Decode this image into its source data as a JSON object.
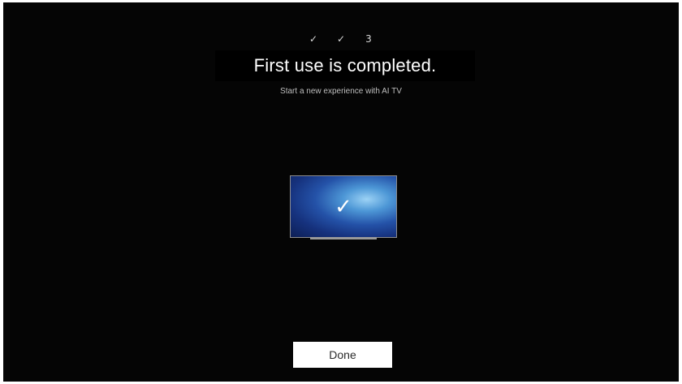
{
  "progress": {
    "steps": [
      "✓",
      "✓",
      "3"
    ]
  },
  "main": {
    "title": "First use is completed.",
    "subtitle": "Start a new experience with AI TV"
  },
  "illustration": {
    "check_glyph": "✓",
    "icon": "tv-check-icon"
  },
  "actions": {
    "done_label": "Done"
  }
}
